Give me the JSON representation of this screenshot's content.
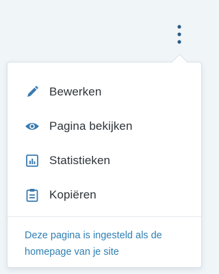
{
  "menu_button": {
    "icon": "vertical-ellipsis-icon",
    "color": "#2d5b82"
  },
  "menu": {
    "items": [
      {
        "label": "Bewerken",
        "icon": "pencil-icon"
      },
      {
        "label": "Pagina bekijken",
        "icon": "eye-icon"
      },
      {
        "label": "Statistieken",
        "icon": "stats-icon"
      },
      {
        "label": "Kopiëren",
        "icon": "clipboard-icon"
      }
    ],
    "note": "Deze pagina is ingesteld als de homepage van je site"
  },
  "colors": {
    "icon": "#3a7bb0",
    "text": "#2c3338",
    "link": "#2e7fb3",
    "background": "#f0f5f8"
  }
}
